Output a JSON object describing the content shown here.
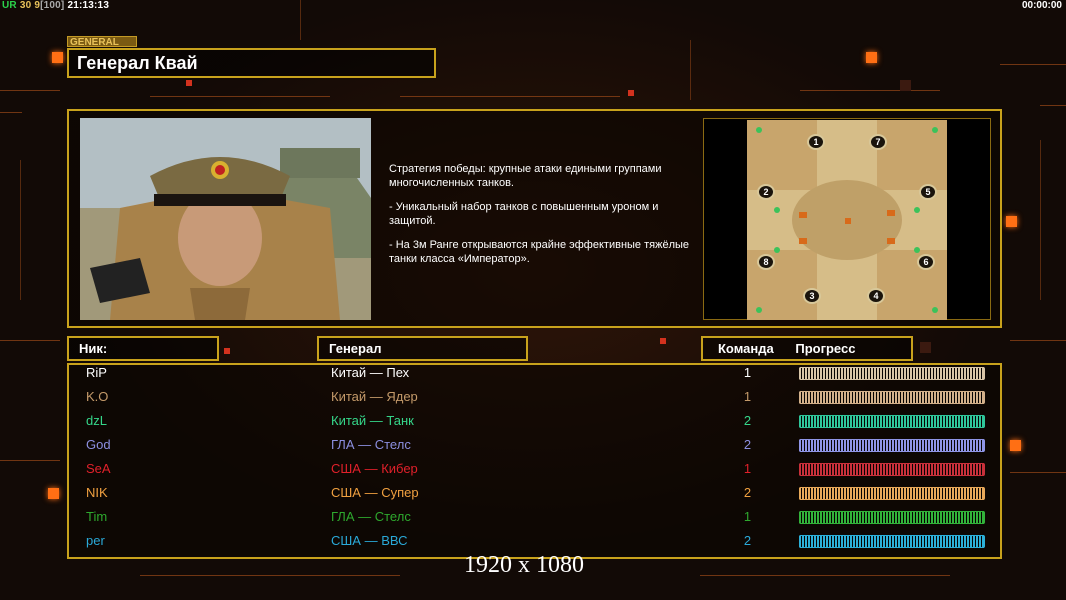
{
  "topbar": {
    "ur_label": "UR",
    "value_a": "30",
    "value_b": "9",
    "bracket": "[100]",
    "clock": "21:13:13",
    "timer": "00:00:00"
  },
  "general": {
    "tag": "GENERAL",
    "name": "Генерал Квай",
    "portrait_icon": "general-portrait",
    "description": [
      "Стратегия победы: крупные атаки едиными  группами многочисленных танков.",
      "- Уникальный набор танков с повышенным уроном  и защитой.",
      "- На 3м Ранге открываются крайне эффективные  тяжёлые танки класса «Император»."
    ]
  },
  "map": {
    "slots": [
      "1",
      "7",
      "2",
      "5",
      "8",
      "6",
      "3",
      "4"
    ]
  },
  "headers": {
    "nick": "Ник:",
    "general": "Генерал",
    "team": "Команда",
    "progress": "Прогресс"
  },
  "players": [
    {
      "nick": "RiP",
      "general": "Китай — Пех",
      "team": "1",
      "color": "#ffffff",
      "bar": "#d9c6a8"
    },
    {
      "nick": "K.O",
      "general": "Китай — Ядер",
      "team": "1",
      "color": "#c49a6a",
      "bar": "#d2b08a"
    },
    {
      "nick": "dzL",
      "general": "Китай — Танк",
      "team": "2",
      "color": "#35d68a",
      "bar": "#2fc69a"
    },
    {
      "nick": "God",
      "general": "ГЛА — Стелс",
      "team": "2",
      "color": "#8c8fe0",
      "bar": "#8f95e6"
    },
    {
      "nick": "SeA",
      "general": "США — Кибер",
      "team": "1",
      "color": "#e0202a",
      "bar": "#c8303a"
    },
    {
      "nick": "NIK",
      "general": "США — Супер",
      "team": "2",
      "color": "#f0a040",
      "bar": "#e8a95a"
    },
    {
      "nick": "Tim",
      "general": "ГЛА — Стелс",
      "team": "1",
      "color": "#2ea82e",
      "bar": "#32b23a"
    },
    {
      "nick": "per",
      "general": "США — ВВС",
      "team": "2",
      "color": "#2aa9d8",
      "bar": "#2cb0d8"
    }
  ],
  "footer": "1920 x 1080"
}
